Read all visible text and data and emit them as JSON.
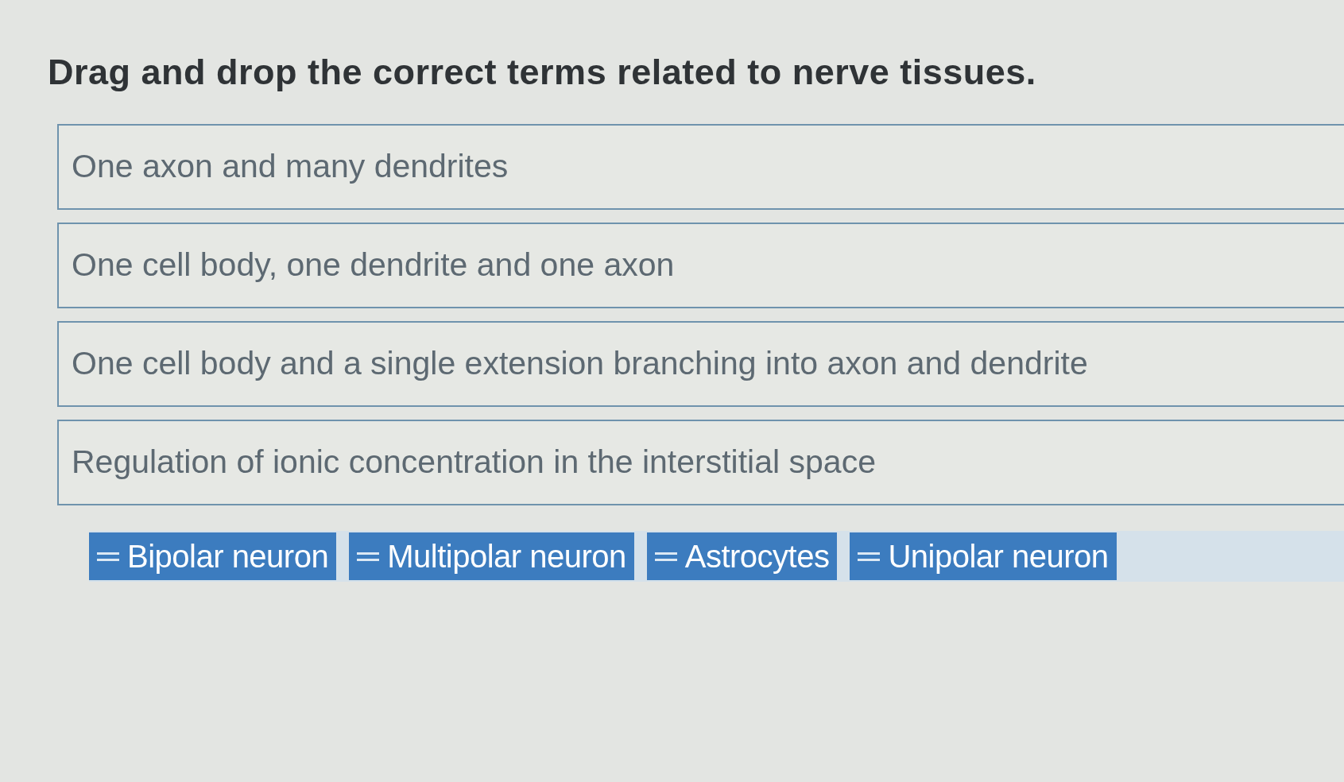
{
  "title": "Drag and drop the correct terms related to nerve tissues.",
  "drop_targets": [
    {
      "description": "One axon and many dendrites"
    },
    {
      "description": "One cell body, one dendrite and one axon"
    },
    {
      "description": "One cell body and a single extension branching into axon and dendrite"
    },
    {
      "description": "Regulation of ionic concentration in the interstitial space"
    }
  ],
  "answer_choices": [
    {
      "label": "Bipolar neuron"
    },
    {
      "label": "Multipolar neuron"
    },
    {
      "label": "Astrocytes"
    },
    {
      "label": "Unipolar neuron"
    }
  ]
}
